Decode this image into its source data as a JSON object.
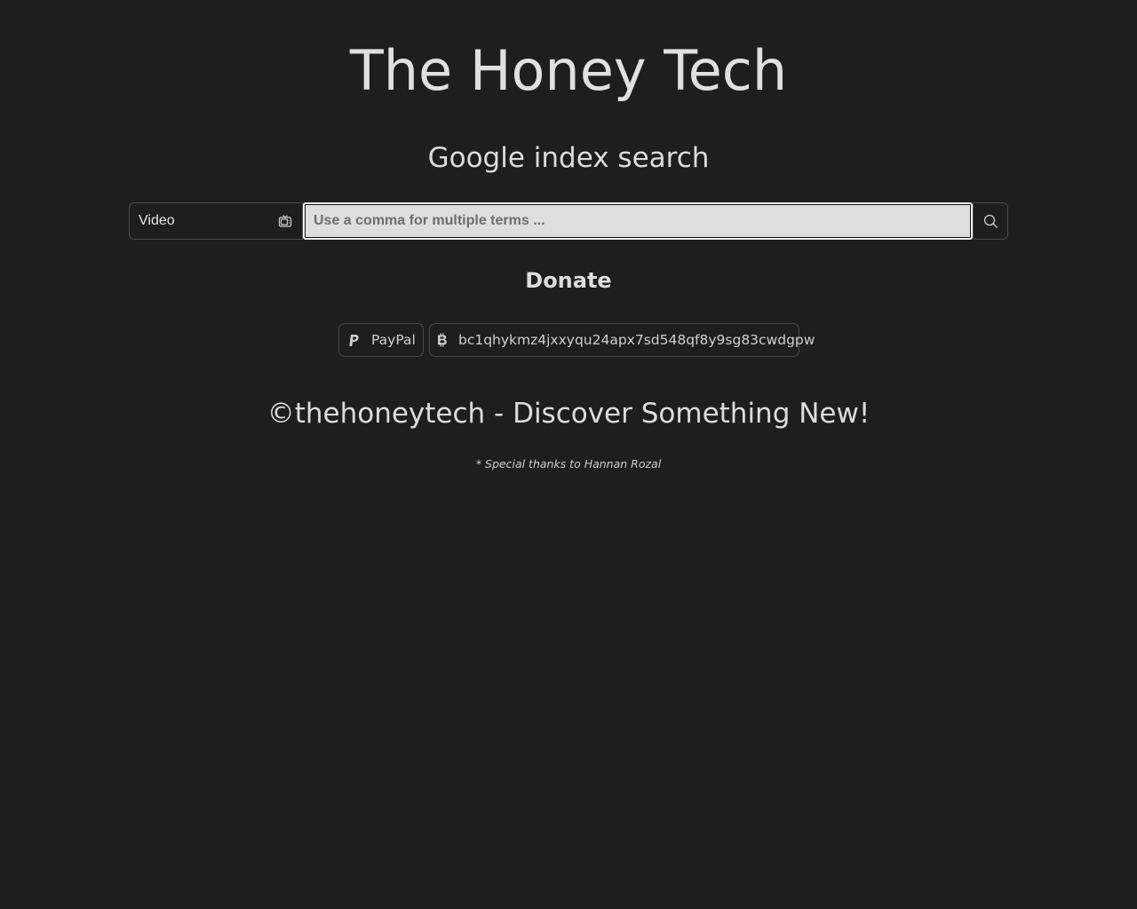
{
  "header": {
    "title": "The Honey Tech",
    "subtitle": "Google index search"
  },
  "search": {
    "type_value": "Video",
    "type_icon": "tv-icon",
    "placeholder": "Use a comma for multiple terms ...",
    "value": "",
    "submit_icon": "search-icon"
  },
  "donate": {
    "heading": "Donate",
    "paypal_label": "PayPal",
    "paypal_icon": "paypal-icon",
    "bitcoin_address": "bc1qhykmz4jxxyqu24apx7sd548qf8y9sg83cwdgpw",
    "bitcoin_icon": "bitcoin-icon"
  },
  "footer": {
    "copyright": "©thehoneytech - Discover Something New!",
    "thanks": "* Special thanks to Hannan Rozal"
  }
}
